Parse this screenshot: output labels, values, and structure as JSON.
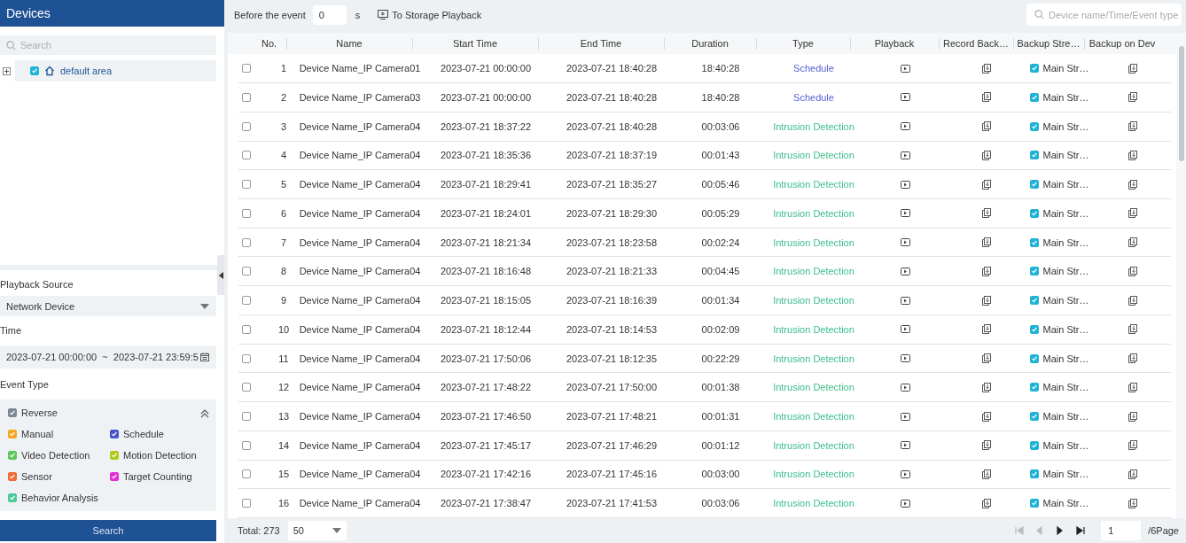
{
  "sidebar": {
    "title": "Devices",
    "search_placeholder": "Search",
    "tree": [
      {
        "label": "default area",
        "checked": true,
        "expanded": false
      }
    ],
    "playback_source_label": "Playback Source",
    "playback_source": "Network Device",
    "time_label": "Time",
    "time_range": "2023-07-21 00:00:00  ~  2023-07-21 23:59:5",
    "event_type_label": "Event Type",
    "event_types_expanded": true,
    "event_types": [
      {
        "label": "Reverse",
        "checked": true,
        "color": "#7b8896"
      },
      {
        "label": "Manual",
        "checked": true,
        "color": "#f5a623"
      },
      {
        "label": "Schedule",
        "checked": true,
        "color": "#4b55c8"
      },
      {
        "label": "Video Detection",
        "checked": true,
        "color": "#5cc85c"
      },
      {
        "label": "Motion Detection",
        "checked": true,
        "color": "#b2c91a"
      },
      {
        "label": "Sensor",
        "checked": true,
        "color": "#f26b38"
      },
      {
        "label": "Target Counting",
        "checked": true,
        "color": "#e02fd6"
      },
      {
        "label": "Behavior Analysis",
        "checked": true,
        "color": "#4fc89d"
      }
    ],
    "search_button": "Search"
  },
  "toolbar": {
    "before_label": "Before the event",
    "before_value": "0",
    "unit": "s",
    "storage_button": "To Storage Playback",
    "search_placeholder": "Device name/Time/Event type"
  },
  "table": {
    "columns": [
      "No.",
      "Name",
      "Start Time",
      "End Time",
      "Duration",
      "Type",
      "Playback",
      "Record Back…",
      "Backup Stre…",
      "Backup on Dev"
    ],
    "rows": [
      {
        "checked": false,
        "no": "1",
        "name": "Device Name_IP Camera01",
        "start": "2023-07-21 00:00:00",
        "end": "2023-07-21 18:40:28",
        "duration": "18:40:28",
        "type": "Schedule",
        "color": "#5563d0",
        "backup_checked": true,
        "backup_stream": "Main Str…"
      },
      {
        "checked": false,
        "no": "2",
        "name": "Device Name_IP Camera03",
        "start": "2023-07-21 00:00:00",
        "end": "2023-07-21 18:40:28",
        "duration": "18:40:28",
        "type": "Schedule",
        "color": "#5563d0",
        "backup_checked": true,
        "backup_stream": "Main Str…"
      },
      {
        "checked": false,
        "no": "3",
        "name": "Device Name_IP Camera04",
        "start": "2023-07-21 18:37:22",
        "end": "2023-07-21 18:40:28",
        "duration": "00:03:06",
        "type": "Intrusion Detection",
        "color": "#3dbf8c",
        "backup_checked": true,
        "backup_stream": "Main Str…"
      },
      {
        "checked": false,
        "no": "4",
        "name": "Device Name_IP Camera04",
        "start": "2023-07-21 18:35:36",
        "end": "2023-07-21 18:37:19",
        "duration": "00:01:43",
        "type": "Intrusion Detection",
        "color": "#3dbf8c",
        "backup_checked": true,
        "backup_stream": "Main Str…"
      },
      {
        "checked": false,
        "no": "5",
        "name": "Device Name_IP Camera04",
        "start": "2023-07-21 18:29:41",
        "end": "2023-07-21 18:35:27",
        "duration": "00:05:46",
        "type": "Intrusion Detection",
        "color": "#3dbf8c",
        "backup_checked": true,
        "backup_stream": "Main Str…"
      },
      {
        "checked": false,
        "no": "6",
        "name": "Device Name_IP Camera04",
        "start": "2023-07-21 18:24:01",
        "end": "2023-07-21 18:29:30",
        "duration": "00:05:29",
        "type": "Intrusion Detection",
        "color": "#3dbf8c",
        "backup_checked": true,
        "backup_stream": "Main Str…"
      },
      {
        "checked": false,
        "no": "7",
        "name": "Device Name_IP Camera04",
        "start": "2023-07-21 18:21:34",
        "end": "2023-07-21 18:23:58",
        "duration": "00:02:24",
        "type": "Intrusion Detection",
        "color": "#3dbf8c",
        "backup_checked": true,
        "backup_stream": "Main Str…"
      },
      {
        "checked": false,
        "no": "8",
        "name": "Device Name_IP Camera04",
        "start": "2023-07-21 18:16:48",
        "end": "2023-07-21 18:21:33",
        "duration": "00:04:45",
        "type": "Intrusion Detection",
        "color": "#3dbf8c",
        "backup_checked": true,
        "backup_stream": "Main Str…"
      },
      {
        "checked": false,
        "no": "9",
        "name": "Device Name_IP Camera04",
        "start": "2023-07-21 18:15:05",
        "end": "2023-07-21 18:16:39",
        "duration": "00:01:34",
        "type": "Intrusion Detection",
        "color": "#3dbf8c",
        "backup_checked": true,
        "backup_stream": "Main Str…"
      },
      {
        "checked": false,
        "no": "10",
        "name": "Device Name_IP Camera04",
        "start": "2023-07-21 18:12:44",
        "end": "2023-07-21 18:14:53",
        "duration": "00:02:09",
        "type": "Intrusion Detection",
        "color": "#3dbf8c",
        "backup_checked": true,
        "backup_stream": "Main Str…"
      },
      {
        "checked": false,
        "no": "11",
        "name": "Device Name_IP Camera04",
        "start": "2023-07-21 17:50:06",
        "end": "2023-07-21 18:12:35",
        "duration": "00:22:29",
        "type": "Intrusion Detection",
        "color": "#3dbf8c",
        "backup_checked": true,
        "backup_stream": "Main Str…"
      },
      {
        "checked": false,
        "no": "12",
        "name": "Device Name_IP Camera04",
        "start": "2023-07-21 17:48:22",
        "end": "2023-07-21 17:50:00",
        "duration": "00:01:38",
        "type": "Intrusion Detection",
        "color": "#3dbf8c",
        "backup_checked": true,
        "backup_stream": "Main Str…"
      },
      {
        "checked": false,
        "no": "13",
        "name": "Device Name_IP Camera04",
        "start": "2023-07-21 17:46:50",
        "end": "2023-07-21 17:48:21",
        "duration": "00:01:31",
        "type": "Intrusion Detection",
        "color": "#3dbf8c",
        "backup_checked": true,
        "backup_stream": "Main Str…"
      },
      {
        "checked": false,
        "no": "14",
        "name": "Device Name_IP Camera04",
        "start": "2023-07-21 17:45:17",
        "end": "2023-07-21 17:46:29",
        "duration": "00:01:12",
        "type": "Intrusion Detection",
        "color": "#3dbf8c",
        "backup_checked": true,
        "backup_stream": "Main Str…"
      },
      {
        "checked": false,
        "no": "15",
        "name": "Device Name_IP Camera04",
        "start": "2023-07-21 17:42:16",
        "end": "2023-07-21 17:45:16",
        "duration": "00:03:00",
        "type": "Intrusion Detection",
        "color": "#3dbf8c",
        "backup_checked": true,
        "backup_stream": "Main Str…"
      },
      {
        "checked": false,
        "no": "16",
        "name": "Device Name_IP Camera04",
        "start": "2023-07-21 17:38:47",
        "end": "2023-07-21 17:41:53",
        "duration": "00:03:06",
        "type": "Intrusion Detection",
        "color": "#3dbf8c",
        "backup_checked": true,
        "backup_stream": "Main Str…"
      }
    ]
  },
  "pager": {
    "total": "Total: 273",
    "page_size": "50",
    "buttons": [
      {
        "kind": "first",
        "disabled": true
      },
      {
        "kind": "prev",
        "disabled": true
      },
      {
        "kind": "next",
        "disabled": false
      },
      {
        "kind": "last",
        "disabled": false
      }
    ],
    "page": "1",
    "pages": "/6Page"
  }
}
